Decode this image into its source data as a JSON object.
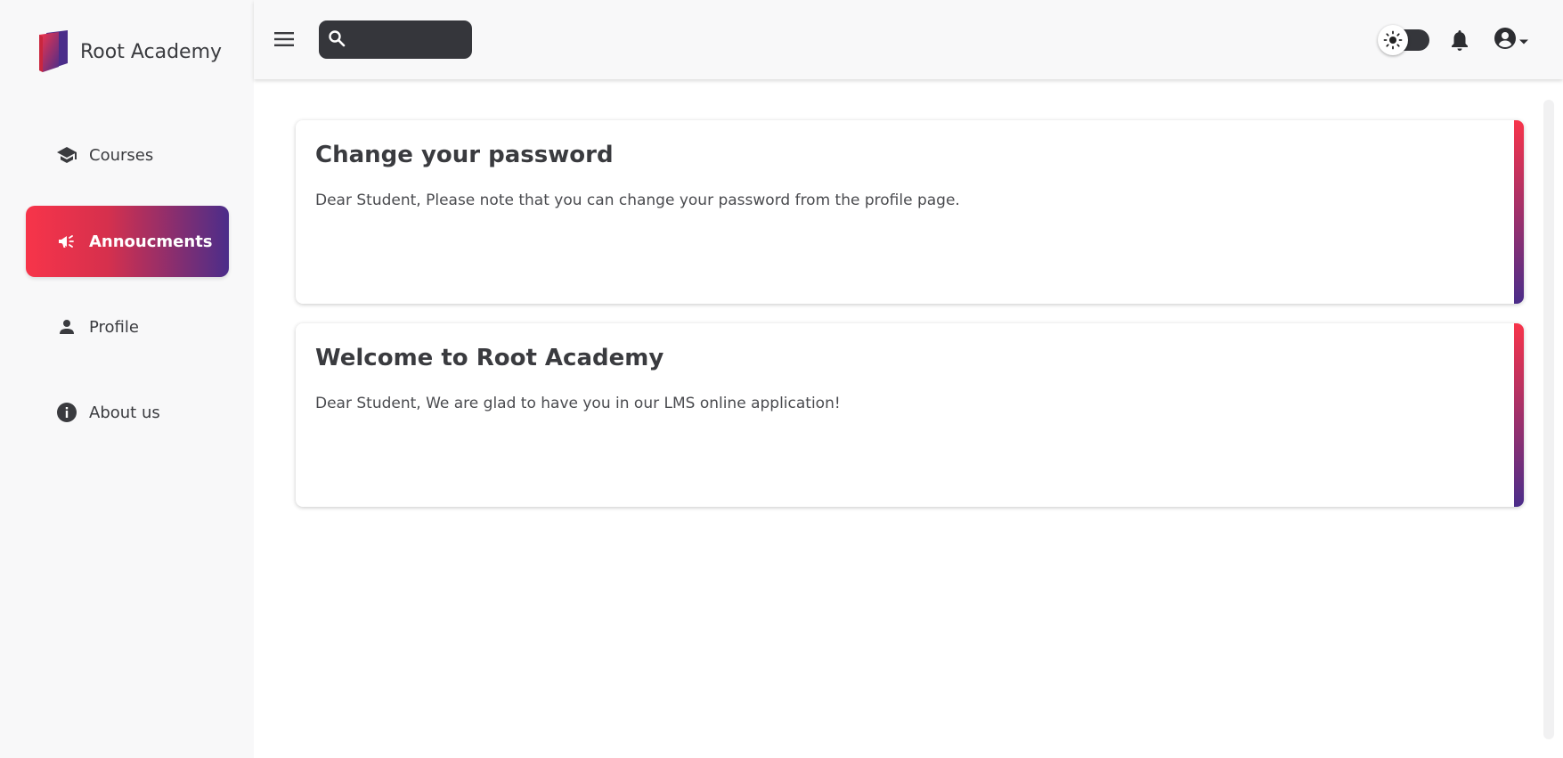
{
  "brand": {
    "name": "Root Academy",
    "logo_icon": "book-logo-icon"
  },
  "sidebar": {
    "items": [
      {
        "label": "Courses",
        "icon": "graduation-cap-icon",
        "active": false
      },
      {
        "label": "Annoucments",
        "icon": "megaphone-icon",
        "active": true
      },
      {
        "label": "Profile",
        "icon": "person-icon",
        "active": false
      },
      {
        "label": "About us",
        "icon": "info-icon",
        "active": false
      }
    ]
  },
  "topbar": {
    "menu_icon": "hamburger-menu-icon",
    "search": {
      "icon": "search-icon",
      "value": "",
      "placeholder": ""
    },
    "theme_toggle": {
      "icon": "sun-icon",
      "mode": "light"
    },
    "notifications_icon": "bell-icon",
    "account_icon": "account-circle-icon",
    "account_menu_icon": "caret-down-icon"
  },
  "announcements": [
    {
      "title": "Change your password",
      "body": "Dear Student, Please note that you can change your password from the profile page."
    },
    {
      "title": "Welcome to Root Academy",
      "body": "Dear Student, We are glad to have you in our LMS online application!"
    }
  ],
  "colors": {
    "accent_start": "#f7344a",
    "accent_end": "#4b2d8a",
    "sidebar_bg": "#f8f8f9",
    "search_bg": "#35363b",
    "text": "#3a3b3f"
  }
}
